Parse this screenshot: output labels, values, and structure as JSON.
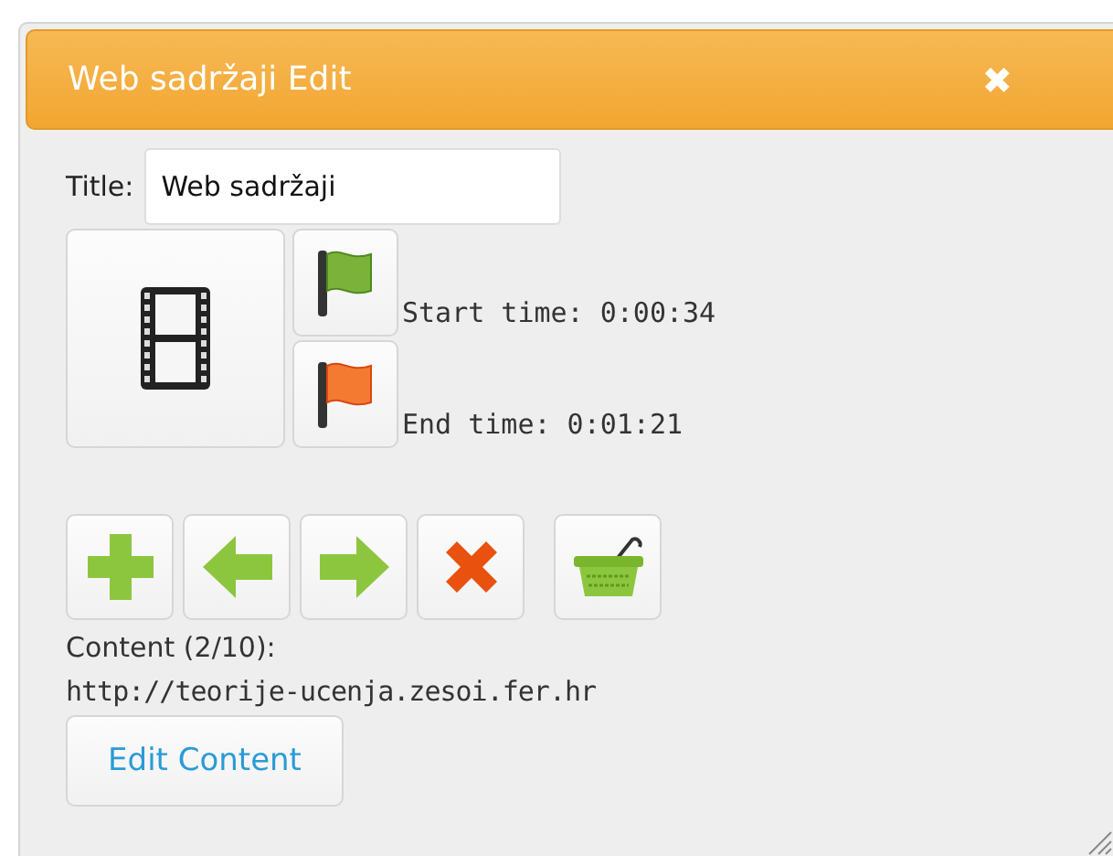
{
  "window": {
    "title": "Web sadržaji Edit",
    "close": "✖"
  },
  "title_field": {
    "label": "Title:",
    "value": "Web sadržaji"
  },
  "times": [
    {
      "kind": "start",
      "text": "Start time: 0:00:34"
    },
    {
      "kind": "end",
      "text": "End time: 0:01:21"
    }
  ],
  "toolbar": [
    {
      "kind": "add"
    },
    {
      "kind": "previous"
    },
    {
      "kind": "next"
    },
    {
      "kind": "delete"
    },
    {
      "kind": "basket"
    }
  ],
  "content": {
    "count": "Content (2/10):",
    "url": "http://teorije-ucenja.zesoi.fer.hr",
    "edit_button": "Edit Content"
  }
}
